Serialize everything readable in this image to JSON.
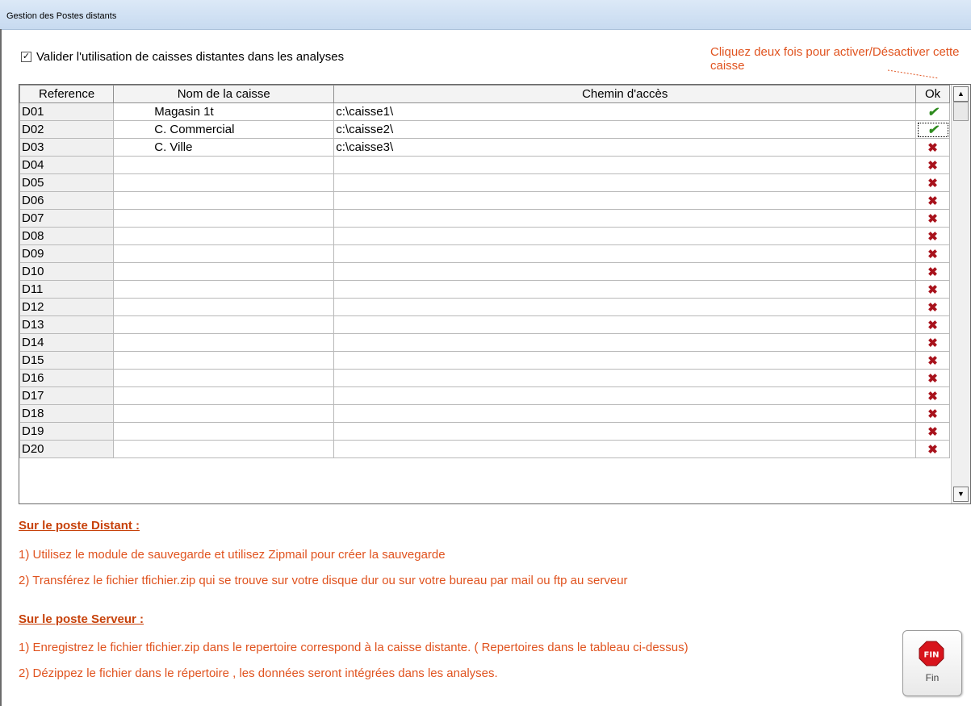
{
  "window": {
    "title": "Gestion des Postes distants"
  },
  "options": {
    "validate_label": "Valider l'utilisation de caisses distantes dans les analyses",
    "validate_checked": true
  },
  "hint": "Cliquez deux fois pour activer/Désactiver cette caisse",
  "grid": {
    "columns": [
      "Reference",
      "Nom de la caisse",
      "Chemin d'accès",
      "Ok"
    ],
    "rows": [
      {
        "ref": "D01",
        "name": "Magasin 1t",
        "path": "c:\\caisse1\\",
        "ok": true
      },
      {
        "ref": "D02",
        "name": "C. Commercial",
        "path": "c:\\caisse2\\",
        "ok": true
      },
      {
        "ref": "D03",
        "name": "C. Ville",
        "path": "c:\\caisse3\\",
        "ok": false
      },
      {
        "ref": "D04",
        "name": "",
        "path": "",
        "ok": false
      },
      {
        "ref": "D05",
        "name": "",
        "path": "",
        "ok": false
      },
      {
        "ref": "D06",
        "name": "",
        "path": "",
        "ok": false
      },
      {
        "ref": "D07",
        "name": "",
        "path": "",
        "ok": false
      },
      {
        "ref": "D08",
        "name": "",
        "path": "",
        "ok": false
      },
      {
        "ref": "D09",
        "name": "",
        "path": "",
        "ok": false
      },
      {
        "ref": "D10",
        "name": "",
        "path": "",
        "ok": false
      },
      {
        "ref": "D11",
        "name": "",
        "path": "",
        "ok": false
      },
      {
        "ref": "D12",
        "name": "",
        "path": "",
        "ok": false
      },
      {
        "ref": "D13",
        "name": "",
        "path": "",
        "ok": false
      },
      {
        "ref": "D14",
        "name": "",
        "path": "",
        "ok": false
      },
      {
        "ref": "D15",
        "name": "",
        "path": "",
        "ok": false
      },
      {
        "ref": "D16",
        "name": "",
        "path": "",
        "ok": false
      },
      {
        "ref": "D17",
        "name": "",
        "path": "",
        "ok": false
      },
      {
        "ref": "D18",
        "name": "",
        "path": "",
        "ok": false
      },
      {
        "ref": "D19",
        "name": "",
        "path": "",
        "ok": false
      },
      {
        "ref": "D20",
        "name": "",
        "path": "",
        "ok": false
      }
    ],
    "selected_ok_row": 2,
    "ok_icon": "check-icon",
    "not_ok_icon": "cross-icon"
  },
  "instructions": {
    "distant": {
      "heading": "Sur le poste Distant :",
      "steps": [
        "1) Utilisez le module de sauvegarde et utilisez Zipmail pour créer la sauvegarde",
        "2) Transférez le fichier tfichier.zip qui se trouve sur votre disque dur ou sur votre bureau par mail ou ftp au serveur"
      ]
    },
    "serveur": {
      "heading": "Sur le poste Serveur :",
      "steps": [
        "1) Enregistrez le fichier tfichier.zip dans le repertoire correspond à la caisse distante. ( Repertoires dans le tableau ci-dessus)",
        "2) Dézippez le fichier dans le répertoire , les données seront intégrées dans les analyses."
      ]
    }
  },
  "buttons": {
    "fin_label": "Fin",
    "fin_icon_text": "FIN"
  },
  "colors": {
    "instruction_text": "#e0531f",
    "heading_text": "#c7420b",
    "check_green": "#2e8b1e",
    "cross_red": "#a8121c"
  }
}
